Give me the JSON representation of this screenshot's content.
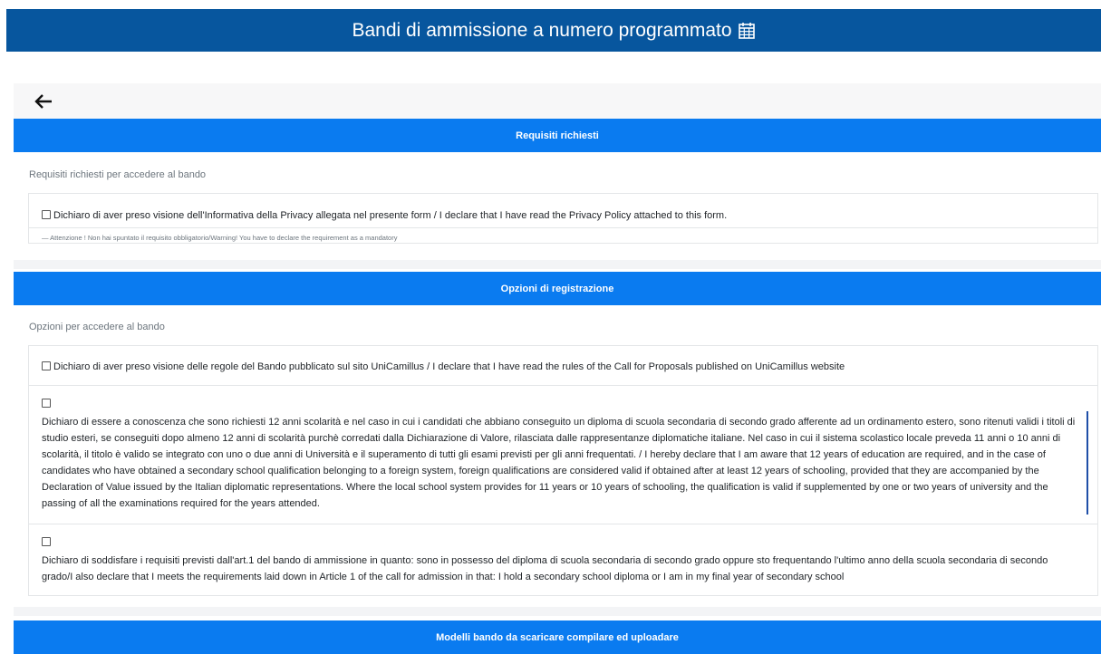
{
  "header": {
    "title": "Bandi di ammissione a numero programmato",
    "icon": "calendar-grid-icon",
    "bg_color": "#07569e"
  },
  "back": {
    "icon": "arrow-left-icon"
  },
  "requisiti": {
    "heading": "Requisiti richiesti",
    "subtitle": "Requisiti richiesti per accedere al bando",
    "items": [
      {
        "label": "Dichiaro di aver preso visione dell'Informativa della Privacy allegata nel presente form / I declare that I have read the Privacy Policy attached to this form.",
        "warning": "— Attenzione ! Non hai spuntato il requisito obbligatorio/Warning! You have to declare the requirement as a mandatory",
        "checked": false
      }
    ]
  },
  "opzioni": {
    "heading": "Opzioni di registrazione",
    "subtitle": "Opzioni per accedere al bando",
    "items": [
      {
        "label": "Dichiaro di aver preso visione delle regole del Bando pubblicato sul sito UniCamillus / I declare that I have read the rules of the Call for Proposals published on UniCamillus website",
        "checked": false
      },
      {
        "label": "Dichiaro di essere a conoscenza che sono richiesti 12 anni scolarità e nel caso in cui i candidati che abbiano conseguito un diploma di scuola secondaria di secondo grado afferente ad un ordinamento estero, sono ritenuti validi i titoli di studio esteri, se conseguiti dopo almeno 12 anni di scolarità purchè corredati dalla Dichiarazione di Valore, rilasciata dalle rappresentanze diplomatiche italiane. Nel caso in cui il sistema scolastico locale preveda 11 anni o 10 anni di scolarità, il titolo è valido se integrato con uno o due anni di Università e il superamento di tutti gli esami previsti per gli anni frequentati. / I hereby declare that I am aware that 12 years of education are required, and in the case of candidates who have obtained a secondary school qualification belonging to a foreign system, foreign qualifications are considered valid if obtained after at least 12 years of schooling, provided that they are accompanied by the Declaration of Value issued by the Italian diplomatic representations. Where the local school system provides for 11 years or 10 years of schooling, the qualification is valid if supplemented by one or two years of university and the passing of all the examinations required for the years attended.",
        "checked": false
      },
      {
        "label": "Dichiaro di soddisfare i requisiti previsti dall'art.1 del bando di ammissione in quanto: sono in possesso del diploma di scuola secondaria di secondo grado oppure sto frequentando l'ultimo anno della scuola secondaria di secondo grado/I also declare that I meets the requirements laid down in Article 1 of the call for admission in that: I hold a secondary school diploma or I am in my final year of secondary school",
        "checked": false
      }
    ]
  },
  "modelli": {
    "heading": "Modelli bando da scaricare compilare ed uploadare"
  },
  "colors": {
    "section_blue": "#0a7bf0",
    "accent_bar": "#1f4fa8"
  }
}
